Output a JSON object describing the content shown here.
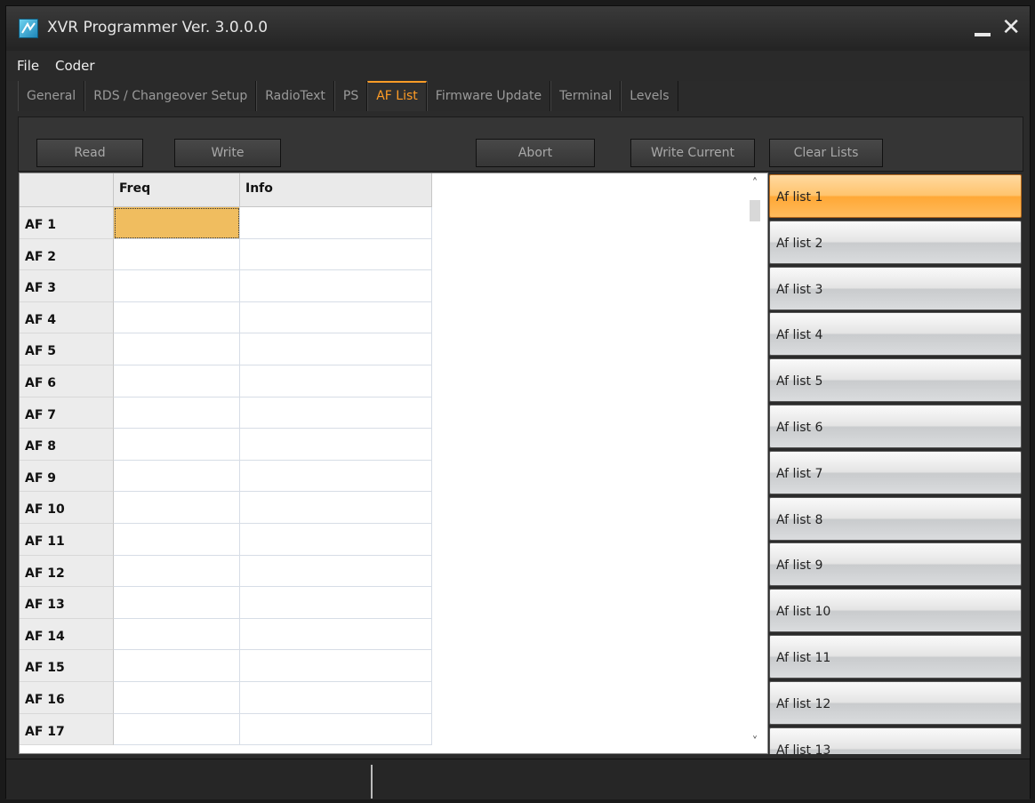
{
  "window": {
    "title": "XVR Programmer  Ver. 3.0.0.0"
  },
  "menu": [
    "File",
    "Coder"
  ],
  "tabs": [
    "General",
    "RDS / Changeover Setup",
    "RadioText",
    "PS",
    "AF List",
    "Firmware Update",
    "Terminal",
    "Levels"
  ],
  "active_tab": "AF List",
  "toolbar": {
    "read": "Read",
    "write": "Write",
    "abort": "Abort",
    "write_current": "Write Current",
    "clear_lists": "Clear Lists"
  },
  "grid": {
    "columns": [
      "Freq",
      "Info"
    ],
    "rows": [
      "AF 1",
      "AF 2",
      "AF 3",
      "AF 4",
      "AF 5",
      "AF 6",
      "AF 7",
      "AF 8",
      "AF 9",
      "AF 10",
      "AF 11",
      "AF 12",
      "AF 13",
      "AF 14",
      "AF 15",
      "AF 16",
      "AF 17"
    ]
  },
  "af_lists": [
    "Af list 1",
    "Af list 2",
    "Af list 3",
    "Af list 4",
    "Af list 5",
    "Af list 6",
    "Af list 7",
    "Af list 8",
    "Af list 9",
    "Af list 10",
    "Af list 11",
    "Af list 12",
    "Af list 13"
  ],
  "active_af_list": "Af list 1",
  "colors": {
    "accent": "#ff9c26",
    "selected_cell": "#f0bd5f"
  }
}
